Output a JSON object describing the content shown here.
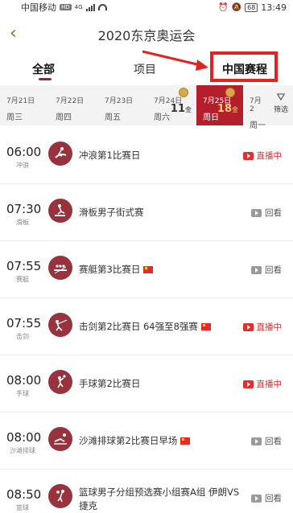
{
  "status_bar": {
    "carrier": "中国移动",
    "hd": "HD",
    "network": "4G",
    "battery": "68",
    "time": "13:49"
  },
  "header": {
    "title": "2020东京奥运会",
    "back_icon": "chevron-left-icon"
  },
  "tabs": [
    {
      "label": "全部",
      "active": true
    },
    {
      "label": "项目",
      "active": false
    },
    {
      "label": "中国赛程",
      "highlighted": true
    }
  ],
  "dates": [
    {
      "date": "7月21日",
      "weekday": "周三"
    },
    {
      "date": "7月22日",
      "weekday": "周四"
    },
    {
      "date": "7月23日",
      "weekday": "周五"
    },
    {
      "date": "7月24日",
      "weekday": "周六",
      "golds": "11",
      "gold_unit": "金"
    },
    {
      "date": "7月25日",
      "weekday": "周日",
      "golds": "18",
      "gold_unit": "金",
      "active": true
    },
    {
      "date": "7月2",
      "weekday": "周一"
    }
  ],
  "filter_label": "筛选",
  "events": [
    {
      "time": "06:00",
      "sport": "冲浪",
      "name": "冲浪第1比赛日",
      "flag": false,
      "status": "直播中",
      "live": true
    },
    {
      "time": "07:30",
      "sport": "滑板",
      "name": "滑板男子街式赛",
      "flag": false,
      "status": "回看",
      "live": false
    },
    {
      "time": "07:55",
      "sport": "赛艇",
      "name": "赛艇第3比赛日",
      "flag": true,
      "status": "回看",
      "live": false
    },
    {
      "time": "07:55",
      "sport": "击剑",
      "name": "击剑第2比赛日 64强至8强赛",
      "flag": true,
      "status": "直播中",
      "live": true
    },
    {
      "time": "08:00",
      "sport": "手球",
      "name": "手球第2比赛日",
      "flag": false,
      "status": "直播中",
      "live": true
    },
    {
      "time": "08:00",
      "sport": "沙滩排球",
      "name": "沙滩排球第2比赛日早场",
      "flag": true,
      "status": "回看",
      "live": false
    },
    {
      "time": "08:50",
      "sport": "篮球",
      "name": "篮球男子分组预选赛小组赛A组 伊朗VS捷克",
      "flag": false,
      "status": "回看",
      "live": false
    }
  ],
  "colors": {
    "accent": "#b51e2c",
    "live": "#e03030",
    "pictogram": "#98333d",
    "annotation": "#e02424"
  }
}
